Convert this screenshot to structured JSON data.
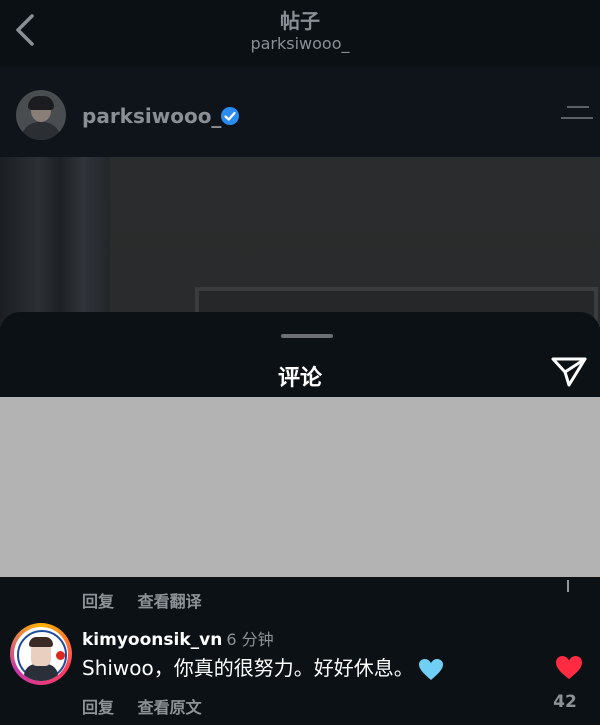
{
  "header": {
    "title": "帖子",
    "subtitle": "parksiwooo_"
  },
  "post": {
    "username": "parksiwooo_"
  },
  "comments_sheet": {
    "title": "评论"
  },
  "prev_comment_actions": {
    "reply": "回复",
    "translate": "查看翻译"
  },
  "comment": {
    "username": "kimyoonsik_vn",
    "time": "6 分钟",
    "text": "Shiwoo，你真的很努力。好好休息。",
    "reply": "回复",
    "view_original": "查看原文",
    "like_count": "42"
  },
  "colors": {
    "accent_like": "#ff2b42",
    "verified": "#2b8cf0",
    "heart_emoji": "#6fcff5"
  }
}
